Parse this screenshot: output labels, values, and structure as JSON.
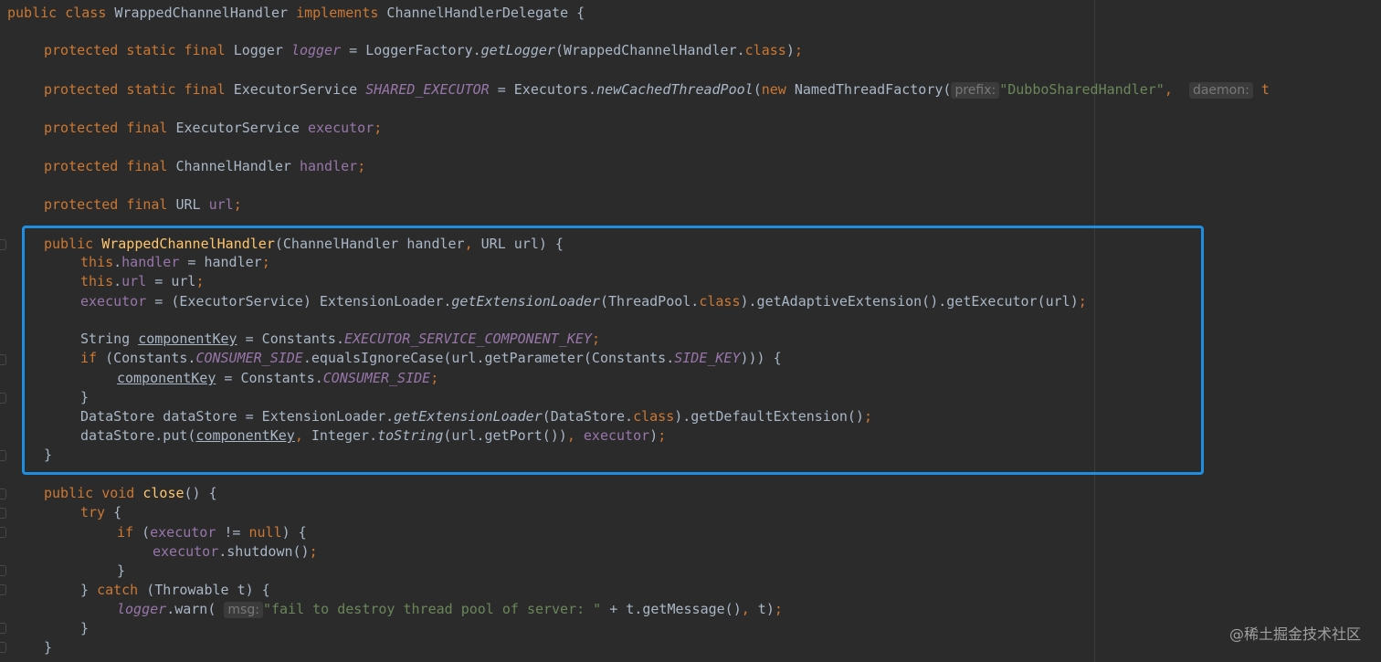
{
  "code": {
    "l1": [
      "public",
      " ",
      "class",
      " WrappedChannelHandler ",
      "implements",
      " ChannelHandlerDelegate {"
    ],
    "l2": [
      "protected",
      " ",
      "static",
      " ",
      "final",
      " Logger ",
      "logger",
      " = LoggerFactory.",
      "getLogger",
      "(WrappedChannelHandler.",
      "class",
      ")",
      ";"
    ],
    "l3": [
      "protected",
      " ",
      "static",
      " ",
      "final",
      " ExecutorService ",
      "SHARED_EXECUTOR",
      " = Executors.",
      "newCachedThreadPool",
      "(",
      "new",
      " NamedThreadFactory(",
      "prefix:",
      "\"DubboSharedHandler\"",
      ",  ",
      "daemon:",
      " t"
    ],
    "l4": [
      "protected",
      " ",
      "final",
      " ExecutorService ",
      "executor",
      ";"
    ],
    "l5": [
      "protected",
      " ",
      "final",
      " ChannelHandler ",
      "handler",
      ";"
    ],
    "l6": [
      "protected",
      " ",
      "final",
      " URL ",
      "url",
      ";"
    ],
    "l7": [
      "public",
      " ",
      "WrappedChannelHandler",
      "(ChannelHandler handler",
      ",",
      " URL url) {"
    ],
    "l8": [
      "this",
      ".",
      "handler",
      " = handler",
      ";"
    ],
    "l9": [
      "this",
      ".",
      "url",
      " = url",
      ";"
    ],
    "l10": [
      "executor",
      " = (ExecutorService) ExtensionLoader.",
      "getExtensionLoader",
      "(ThreadPool.",
      "class",
      ").getAdaptiveExtension().getExecutor(url)",
      ";"
    ],
    "l11": [
      "String ",
      "componentKey",
      " = Constants.",
      "EXECUTOR_SERVICE_COMPONENT_KEY",
      ";"
    ],
    "l12": [
      "if",
      " (Constants.",
      "CONSUMER_SIDE",
      ".equalsIgnoreCase(url.getParameter(Constants.",
      "SIDE_KEY",
      "))) {"
    ],
    "l13": [
      "componentKey",
      " = Constants.",
      "CONSUMER_SIDE",
      ";"
    ],
    "l14": [
      "}"
    ],
    "l15": [
      "DataStore dataStore = ExtensionLoader.",
      "getExtensionLoader",
      "(DataStore.",
      "class",
      ").getDefaultExtension()",
      ";"
    ],
    "l16": [
      "dataStore.put(",
      "componentKey",
      ",",
      " Integer.",
      "toString",
      "(url.getPort())",
      ",",
      " ",
      "executor",
      ")",
      ";"
    ],
    "l17": [
      "}"
    ],
    "l18": [
      "public",
      " ",
      "void",
      " ",
      "close",
      "() {"
    ],
    "l19": [
      "try",
      " {"
    ],
    "l20": [
      "if",
      " (",
      "executor",
      " != ",
      "null",
      ") {"
    ],
    "l21": [
      "executor",
      ".shutdown()",
      ";"
    ],
    "l22": [
      "}"
    ],
    "l23": [
      "} ",
      "catch",
      " (Throwable t) {"
    ],
    "l24": [
      "logger",
      ".warn( ",
      "msg:",
      "\"fail to destroy thread pool of server: \"",
      " + t.getMessage()",
      ",",
      " t)",
      ";"
    ],
    "l25": [
      "}"
    ],
    "l26": [
      "}"
    ]
  },
  "watermark": "@稀土掘金技术社区",
  "colors": {
    "background": "#2b2b2b",
    "keyword": "#cc7832",
    "field": "#9876aa",
    "method_declaration": "#ffc66d",
    "string": "#6a8759",
    "plain": "#a9b7c6",
    "highlight_border": "#1e8fe0"
  }
}
